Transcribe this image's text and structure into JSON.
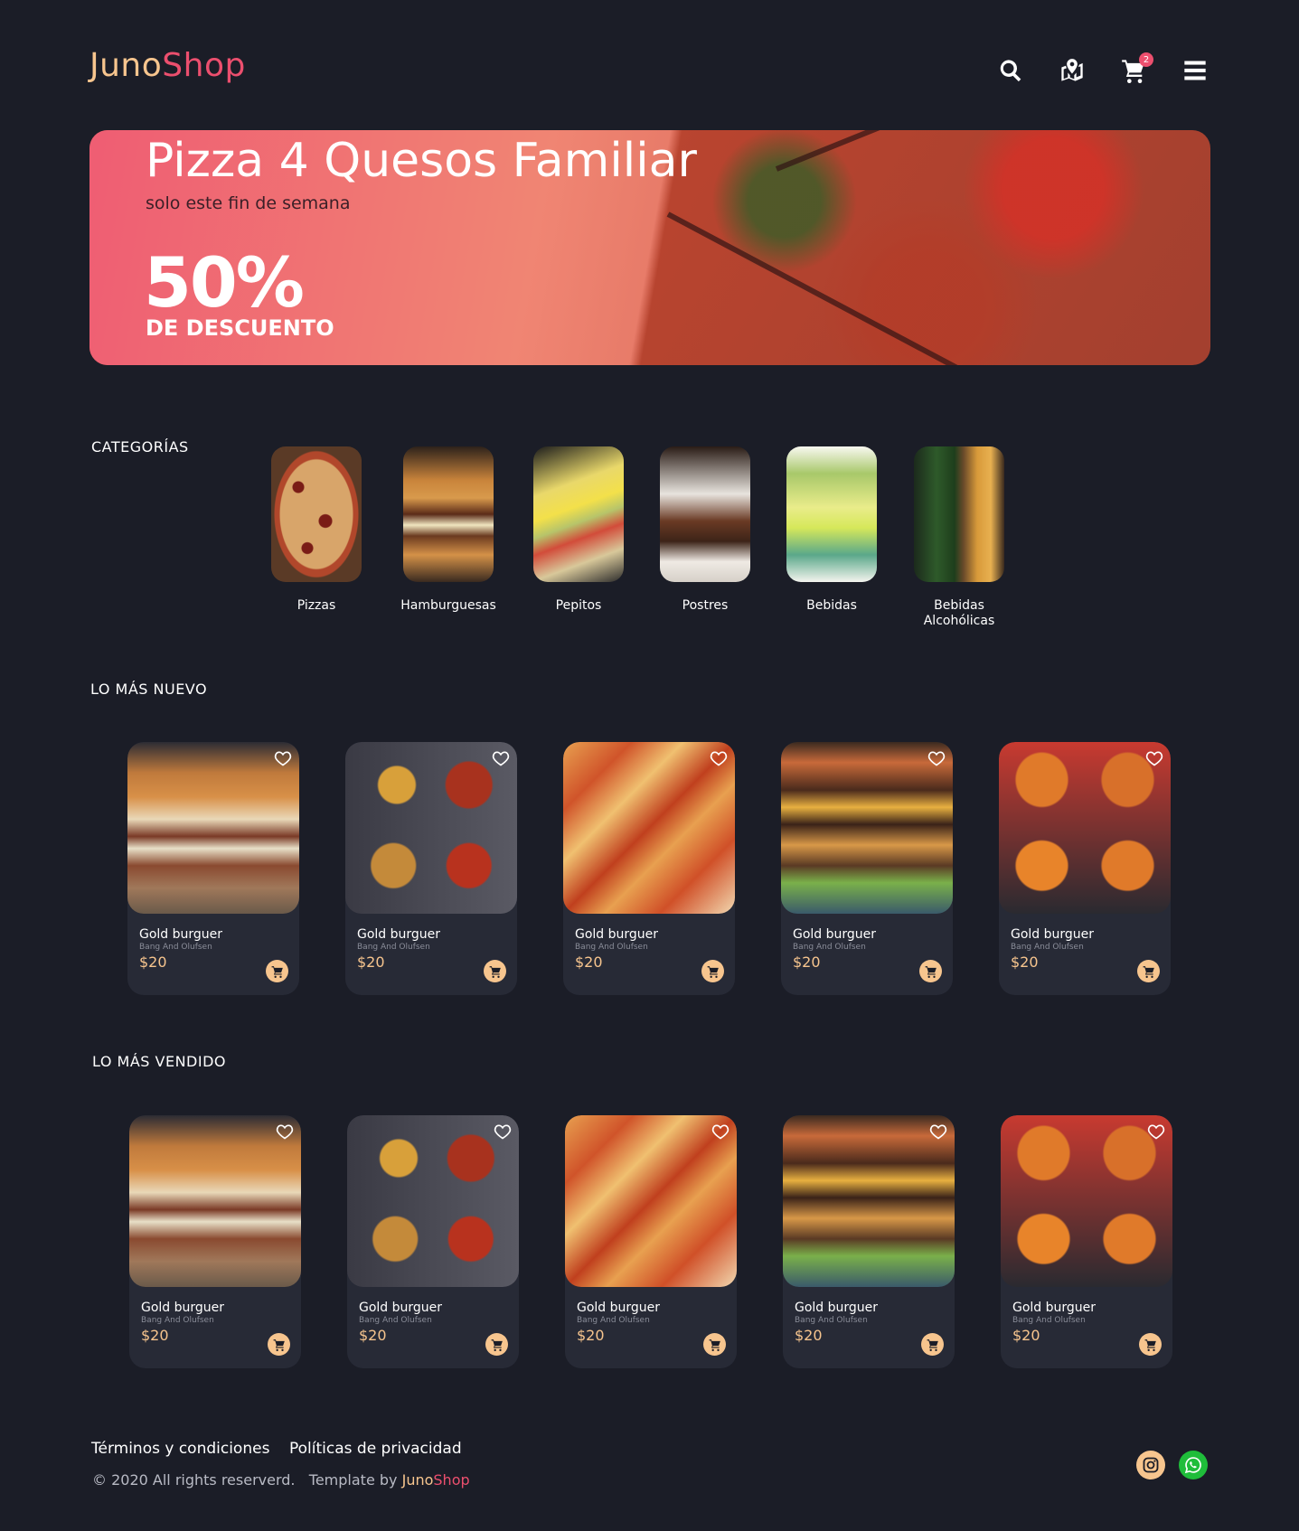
{
  "brand": {
    "part1": "Juno",
    "part2": "Shop"
  },
  "header": {
    "cart_count": "2"
  },
  "banner": {
    "title": "Pizza 4 Quesos Familiar",
    "subtitle": "solo este fin de semana",
    "percent": "50%",
    "discount": "DE DESCUENTO"
  },
  "categories": {
    "title": "CATEGORÍAS",
    "items": [
      {
        "label": "Pizzas"
      },
      {
        "label": "Hamburguesas"
      },
      {
        "label": "Pepitos"
      },
      {
        "label": "Postres"
      },
      {
        "label": "Bebidas"
      },
      {
        "label": "Bebidas Alcohólicas"
      }
    ]
  },
  "newest": {
    "title": "LO MÁS NUEVO",
    "products": [
      {
        "name": "Gold burguer",
        "brand": "Bang And Olufsen",
        "price": "$20"
      },
      {
        "name": "Gold burguer",
        "brand": "Bang And Olufsen",
        "price": "$20"
      },
      {
        "name": "Gold burguer",
        "brand": "Bang And Olufsen",
        "price": "$20"
      },
      {
        "name": "Gold burguer",
        "brand": "Bang And Olufsen",
        "price": "$20"
      },
      {
        "name": "Gold burguer",
        "brand": "Bang And Olufsen",
        "price": "$20"
      }
    ]
  },
  "bestsellers": {
    "title": "LO MÁS VENDIDO",
    "products": [
      {
        "name": "Gold burguer",
        "brand": "Bang And Olufsen",
        "price": "$20"
      },
      {
        "name": "Gold burguer",
        "brand": "Bang And Olufsen",
        "price": "$20"
      },
      {
        "name": "Gold burguer",
        "brand": "Bang And Olufsen",
        "price": "$20"
      },
      {
        "name": "Gold burguer",
        "brand": "Bang And Olufsen",
        "price": "$20"
      },
      {
        "name": "Gold burguer",
        "brand": "Bang And Olufsen",
        "price": "$20"
      }
    ]
  },
  "footer": {
    "terms": "Términos y condiciones",
    "privacy": "Políticas de privacidad",
    "copyright": "© 2020 All rights reserverd.",
    "template_by": "Template by",
    "brand1": "Juno",
    "brand2": "Shop"
  },
  "colors": {
    "background": "#1b1d27",
    "accent_gold": "#f7c58e",
    "accent_pink": "#ec4f6e",
    "card": "#272a36"
  }
}
